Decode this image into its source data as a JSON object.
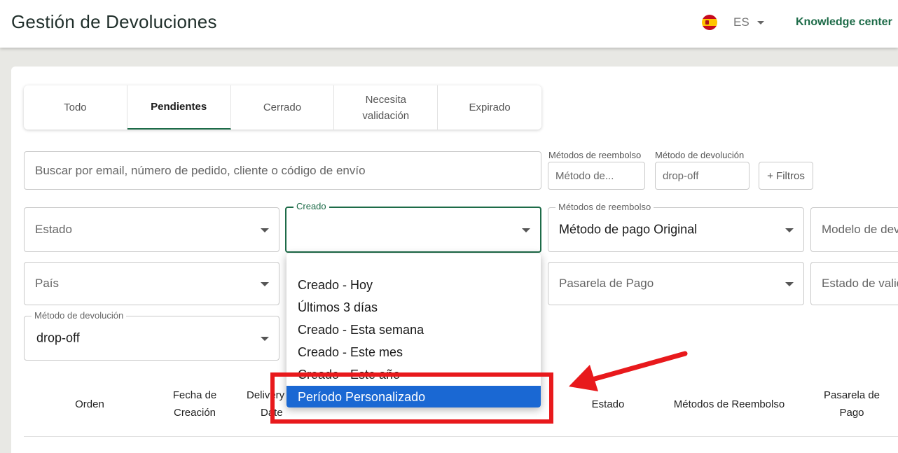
{
  "header": {
    "title": "Gestión de Devoluciones",
    "language": "ES",
    "knowledge_link": "Knowledge center"
  },
  "tabs": [
    {
      "label": "Todo",
      "active": false
    },
    {
      "label": "Pendientes",
      "active": true
    },
    {
      "label": "Cerrado",
      "active": false
    },
    {
      "label": "Necesita validación",
      "active": false
    },
    {
      "label": "Expirado",
      "active": false
    }
  ],
  "search": {
    "placeholder": "Buscar por email, número de pedido, cliente o código de envío"
  },
  "quick_filters": {
    "refund_label": "Métodos de reembolso",
    "refund_value": "Método de...",
    "return_label": "Método de devolución",
    "return_value": "drop-off",
    "more_filters": "+ Filtros"
  },
  "filters": {
    "estado": "Estado",
    "creado_label": "Creado",
    "creado_value": "",
    "refund_label": "Métodos de reembolso",
    "refund_value": "Método de pago Original",
    "modelo": "Modelo de devolución",
    "pais": "País",
    "pasarela": "Pasarela de Pago",
    "estado_validacion": "Estado de validación",
    "return_label": "Método de devolución",
    "return_value": "drop-off"
  },
  "created_menu": {
    "options": [
      "Creado - Hoy",
      "Últimos 3 días",
      "Creado - Esta semana",
      "Creado - Este mes",
      "Creado - Este año",
      "Período Personalizado"
    ],
    "selected_index": 5
  },
  "table": {
    "headers": {
      "orden": "Orden",
      "fecha_1": "Fecha de",
      "fecha_2": "Creación",
      "delivery_1": "Delivery",
      "delivery_2": "Date",
      "estado": "Estado",
      "metodos": "Métodos de Reembolso",
      "pasarela_1": "Pasarela de",
      "pasarela_2": "Pago"
    }
  },
  "colors": {
    "brand_green": "#1d6b48",
    "selected_blue": "#1a68d3",
    "annotation_red": "#e8191c"
  }
}
